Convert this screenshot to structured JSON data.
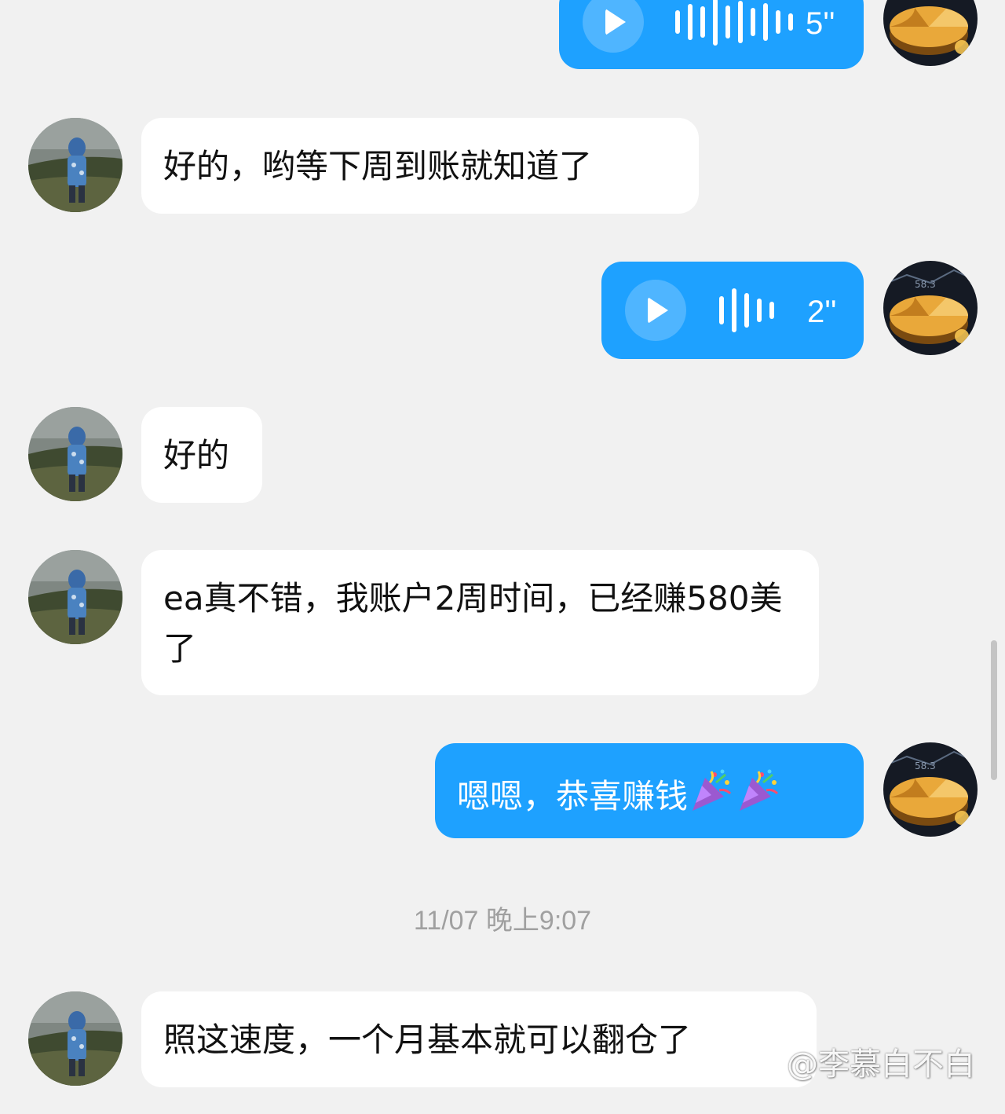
{
  "messages": [
    {
      "type": "voice",
      "side": "self",
      "duration": "5''"
    },
    {
      "type": "text",
      "side": "other",
      "text": "好的，哟等下周到账就知道了"
    },
    {
      "type": "voice",
      "side": "self",
      "duration": "2''"
    },
    {
      "type": "text",
      "side": "other",
      "text": "好的"
    },
    {
      "type": "text",
      "side": "other",
      "text": "ea真不错，我账户2周时间，已经赚580美了"
    },
    {
      "type": "text",
      "side": "self",
      "text": "嗯嗯，恭喜赚钱",
      "emojis": [
        "party-popper",
        "party-popper"
      ]
    },
    {
      "type": "timestamp",
      "text": "11/07 晚上9:07"
    },
    {
      "type": "text",
      "side": "other",
      "text": "照这速度，一个月基本就可以翻仓了"
    }
  ],
  "watermark": {
    "text": "@李慕白不白",
    "icon": "weibo-icon"
  },
  "colors": {
    "background": "#f1f1f1",
    "self_bubble": "#1ea1ff",
    "other_bubble": "#ffffff",
    "timestamp": "#a0a0a0"
  }
}
